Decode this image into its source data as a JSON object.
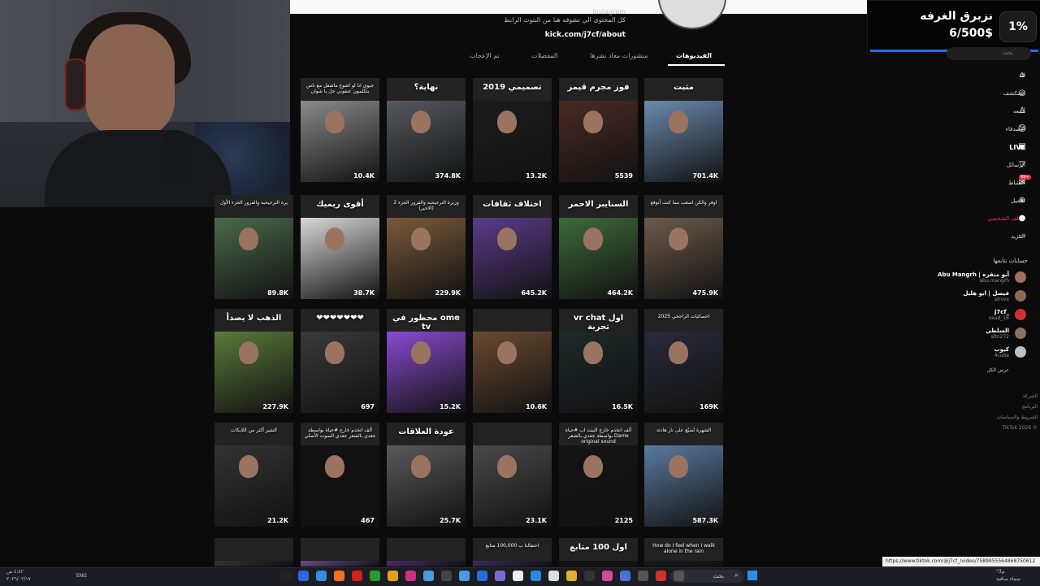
{
  "goal": {
    "title": "نزبرق الغرفه",
    "amount": "6/500$",
    "percent": "1%",
    "progress": 0.01,
    "bar_color": "#1f6fff"
  },
  "profile": {
    "bio": "كل المحتوى الي تشوفه هنا من البثوث الرابط",
    "bio_prefix": "instagram",
    "link": "kick.com/j7cf/about"
  },
  "tabs": [
    {
      "label": "الفيديوهات",
      "active": true
    },
    {
      "label": "منشورات معاد نشرها",
      "active": false
    },
    {
      "label": "المفضلات",
      "active": false
    },
    {
      "label": "تم الإعجاب",
      "active": false
    }
  ],
  "tiles": [
    {
      "views": "701.4K",
      "cap": "مثبت",
      "color": "#6b8ab0"
    },
    {
      "views": "5539",
      "cap": "فوز مجرم قيمز",
      "color": "#4a2a24"
    },
    {
      "views": "13.2K",
      "cap": "تصميمي 2019",
      "color": "#1c1c1c"
    },
    {
      "views": "374.8K",
      "cap": "نهاية؟",
      "color": "#555a60"
    },
    {
      "views": "10.4K",
      "cap": "جيوي انا لو اشوع ماشفل مع ناس يتكلمون عنفوني حل يا شوان",
      "color": "#8a8a8a"
    },
    {
      "views": "475.9K",
      "cap": "اوفر والكن اصعب مما كنت أتوقع",
      "color": "#6d5a4a"
    },
    {
      "views": "464.2K",
      "cap": "السنايبر الاحمر",
      "color": "#3e6a3a"
    },
    {
      "views": "645.2K",
      "cap": "اختلاف ثقافات",
      "color": "#5a3c8a"
    },
    {
      "views": "229.9K",
      "cap": "وزيرة الترجيحيه والفرور الجزء 2 (الاخير)",
      "color": "#7a5a3a"
    },
    {
      "views": "38.7K",
      "cap": "أقوى ريميك",
      "color": "#d8d8d8"
    },
    {
      "views": "89.8K",
      "cap": "يرة الترجيحيه والفرور الجزء الأول",
      "color": "#4a6a4a"
    },
    {
      "views": "169K",
      "cap": "احصائيات الراجحي 2025",
      "color": "#2a2a3a"
    },
    {
      "views": "16.5K",
      "cap": "vr chat اول تجربة",
      "color": "#1e2a2a"
    },
    {
      "views": "10.6K",
      "cap": "",
      "color": "#6a4a30"
    },
    {
      "views": "15.2K",
      "cap": "محظور في ome tv",
      "color": "#8a4ad0"
    },
    {
      "views": "697",
      "cap": "❤❤❤❤❤❤❤",
      "color": "#3a3a3a"
    },
    {
      "views": "227.9K",
      "cap": "الذهب لا يصدأ",
      "color": "#5a7a3a"
    },
    {
      "views": "587.3K",
      "cap": "الشهرة تُضيّع على نار هادئة",
      "color": "#5a7aa0"
    },
    {
      "views": "2125",
      "cap": "ألف اتخذم خارج البيت اب #حياة بواسطة جعدي بالشعر Damo original sound",
      "color": "#141414"
    },
    {
      "views": "23.1K",
      "cap": "",
      "color": "#4a4a4a"
    },
    {
      "views": "25.7K",
      "cap": "عودة العلاقات",
      "color": "#5a5a5a"
    },
    {
      "views": "467",
      "cap": "ألف اتخذم خارج #حياة بواسطة جعدي بالشعر جعدي الصوت الأصلي",
      "color": "#111"
    },
    {
      "views": "21.2K",
      "cap": "الشير أكثر من اللايكات",
      "color": "#333"
    },
    {
      "views": "",
      "cap": "How do I feel when I walk alone in the rain",
      "color": "#1a1a1a"
    },
    {
      "views": "",
      "cap": "اول 100 متابع",
      "color": "#111"
    },
    {
      "views": "",
      "cap": "احتفالنا ب 100,000 متابع",
      "color": "#3a2a5a"
    },
    {
      "views": "",
      "cap": "",
      "color": "#4a2a6a"
    },
    {
      "views": "",
      "cap": "",
      "color": "#6a4a8a"
    },
    {
      "views": "",
      "cap": "",
      "color": "#333"
    }
  ],
  "sidebar": {
    "search_placeholder": "بحث",
    "items": [
      "لك",
      "استكشف",
      "أتابعه",
      "الأصدقاء",
      "LIVE",
      "الرسائل",
      "النشاط",
      "تحميل",
      "الملف الشخصي",
      "المزيد"
    ],
    "badge": "99+",
    "following_title": "حسابات تتابعها",
    "accounts": [
      {
        "name": "Abu Mangrh | أبو منقره",
        "handle": "abu.mangrh",
        "color": "#a07060"
      },
      {
        "name": "فيصل | ابو هليل",
        "handle": "slrvvx",
        "color": "#8a6a5a"
      },
      {
        "name": "j7cf_",
        "handle": "saud_16",
        "color": "#d03030"
      },
      {
        "name": "السلطي",
        "handle": "sltn272",
        "color": "#8a7060"
      },
      {
        "name": "كيوب",
        "handle": "4cube",
        "color": "#c0c0c0"
      }
    ],
    "show_all": "عرض الكل",
    "footer": [
      "الشركة",
      "البرنامج",
      "الشروط والسياسات",
      "TikTok 2026 ©"
    ]
  },
  "taskbar": {
    "clock": "٤:٤٢ ص",
    "date": "٢٠٢٦/٠٢/١٧",
    "lang": "ENG",
    "search": "بحث",
    "weather": "°3م",
    "weather_sub": "سماء صافية",
    "url_tip": "https://www.tiktok.com/@j7cf_/video/7589955564868750612"
  }
}
